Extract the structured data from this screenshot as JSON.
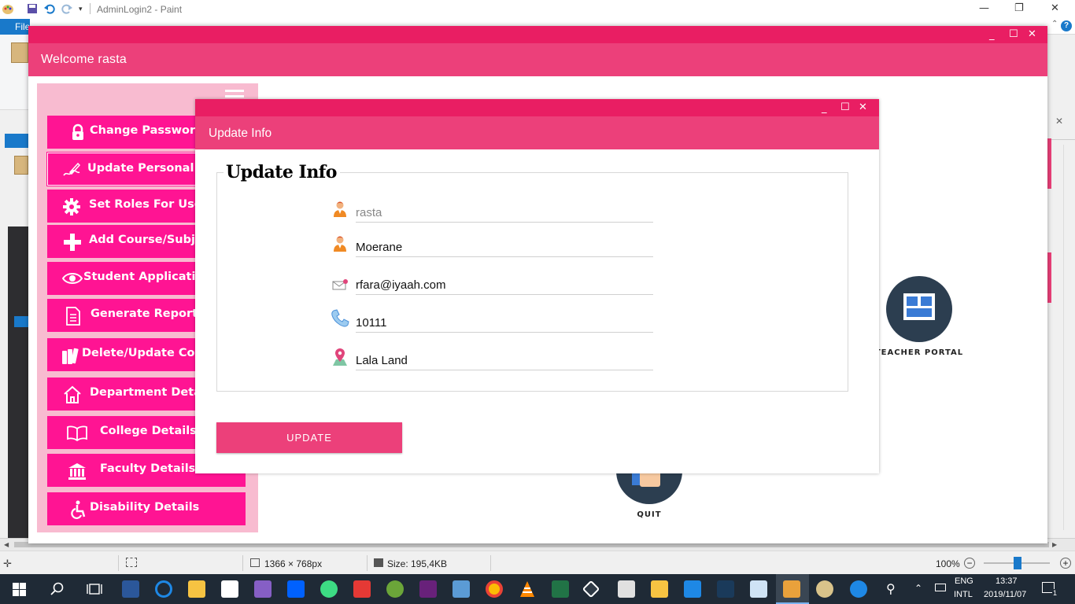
{
  "paint": {
    "window_title": "AdminLogin2 - Paint",
    "file_tab": "File",
    "status": {
      "dimensions": "1366 × 768px",
      "size": "Size: 195,4KB",
      "zoom": "100%"
    }
  },
  "app": {
    "title": "Welcome rasta",
    "menu": [
      {
        "label": "Change Password",
        "icon": "lock-icon"
      },
      {
        "label": "Update Personal Info",
        "icon": "edit-signature-icon"
      },
      {
        "label": "Set Roles For Users",
        "icon": "gear-icon"
      },
      {
        "label": "Add Course/Subjects",
        "icon": "plus-icon"
      },
      {
        "label": "Student Applications",
        "icon": "eye-icon"
      },
      {
        "label": "Generate Report(s)",
        "icon": "document-icon"
      },
      {
        "label": "Delete/Update Courses",
        "icon": "books-icon"
      },
      {
        "label": "Department Details",
        "icon": "building-icon"
      },
      {
        "label": "College Details",
        "icon": "open-book-icon"
      },
      {
        "label": "Faculty Details",
        "icon": "institution-icon"
      },
      {
        "label": "Disability Details",
        "icon": "wheelchair-icon"
      }
    ],
    "teacher_portal_label": "TEACHER PORTAL",
    "quit_label": "QUIT"
  },
  "dialog": {
    "title": "Update Info",
    "group_title": "Update Info",
    "fields": {
      "username": "rasta",
      "surname": "Moerane",
      "email": "rfara@iyaah.com",
      "phone": "10111",
      "address": "Lala Land"
    },
    "update_label": "UPDATE"
  },
  "taskbar": {
    "lang_1": "ENG",
    "lang_2": "INTL",
    "time": "13:37",
    "date": "2019/11/07",
    "notification_count": "1"
  }
}
